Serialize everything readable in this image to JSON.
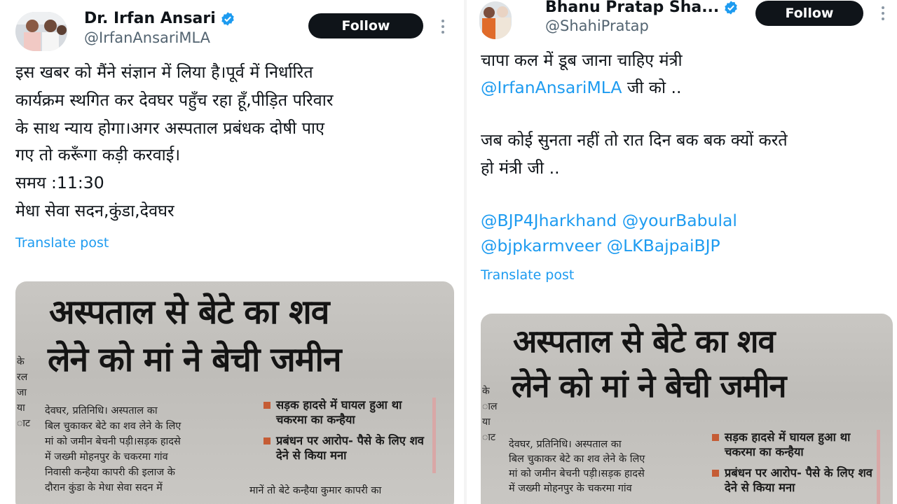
{
  "left": {
    "author": {
      "name": "Dr. Irfan Ansari",
      "handle": "@IrfanAnsariMLA",
      "verified": true
    },
    "follow_label": "Follow",
    "more_icon": "more-vertical-icon",
    "text_lines": [
      "इस खबर को मैंने संज्ञान में लिया है।पूर्व में निर्धारित",
      "कार्यक्रम स्थगित कर देवघर पहुँच रहा हूँ,पीड़ित परिवार",
      "के साथ न्याय होगा।अगर अस्पताल प्रबंधक दोषी पाए",
      "गए तो करूँगा कड़ी करवाई।",
      "समय :11:30",
      "मेधा सेवा सदन,कुंडा,देवघर"
    ],
    "translate_label": "Translate post",
    "media": {
      "headline_1": "अस्पताल से बेटे का शव",
      "headline_2": "लेने को मां ने बेची जमीन",
      "side_fragment": [
        "के",
        "रल",
        "जा",
        "या",
        "ाट"
      ],
      "body_lines": [
        "देवघर, प्रतिनिधि।  अस्पताल का",
        "बिल चुकाकर बेटे का शव लेने के लिए",
        "मां को जमीन बेचनी पड़ी।सड़क हादसे",
        "में जख्मी मोहनपुर के चकरमा गांव",
        "निवासी कन्हैया कापरी की इलाज के",
        "दौरान कुंडा के मेधा सेवा सदन में"
      ],
      "box_items": [
        "सड़क हादसे में घायल हुआ था चकरमा का कन्हैया",
        "प्रबंधन पर आरोप- पैसे के लिए शव देने से किया मना"
      ],
      "box_caption": "मानें तो बेटे कन्हैया कुमार कापरी का"
    }
  },
  "right": {
    "author": {
      "name": "Bhanu Pratap Sha...",
      "handle": "@ShahiPratap",
      "verified": true
    },
    "follow_label": "Follow",
    "more_icon": "more-vertical-icon",
    "line_1": "चापा कल में डूब जाना चाहिए मंत्री",
    "line_2_mention": "@IrfanAnsariMLA",
    "line_2_rest": " जी को ..",
    "line_3": "जब कोई सुनता नहीं तो रात दिन बक बक क्यों करते",
    "line_4": "हो मंत्री जी ..",
    "mentions_1": [
      "@BJP4Jharkhand",
      "@yourBabulal"
    ],
    "mentions_2": [
      "@bjpkarmveer",
      "@LKBajpaiBJP"
    ],
    "translate_label": "Translate post",
    "media": {
      "headline_1": "अस्पताल से बेटे का शव",
      "headline_2": "लेने को मां ने बेची जमीन",
      "side_fragment": [
        "के",
        "ाल",
        "या",
        "ाट"
      ],
      "body_lines": [
        "देवघर, प्रतिनिधि।  अस्पताल का",
        "बिल चुकाकर बेटे का शव लेने के लिए",
        "मां को जमीन बेचनी पड़ी।सड़क हादसे",
        "में जख्मी मोहनपुर के चकरमा गांव"
      ],
      "box_items": [
        "सड़क हादसे में घायल हुआ था चकरमा का कन्हैया",
        "प्रबंधन पर आरोप- पैसे के लिए शव देने से किया मना"
      ]
    }
  },
  "colors": {
    "link": "#1d9bf0",
    "verified": "#1d9bf0",
    "follow_bg": "#0f1419",
    "handle": "#536471"
  }
}
